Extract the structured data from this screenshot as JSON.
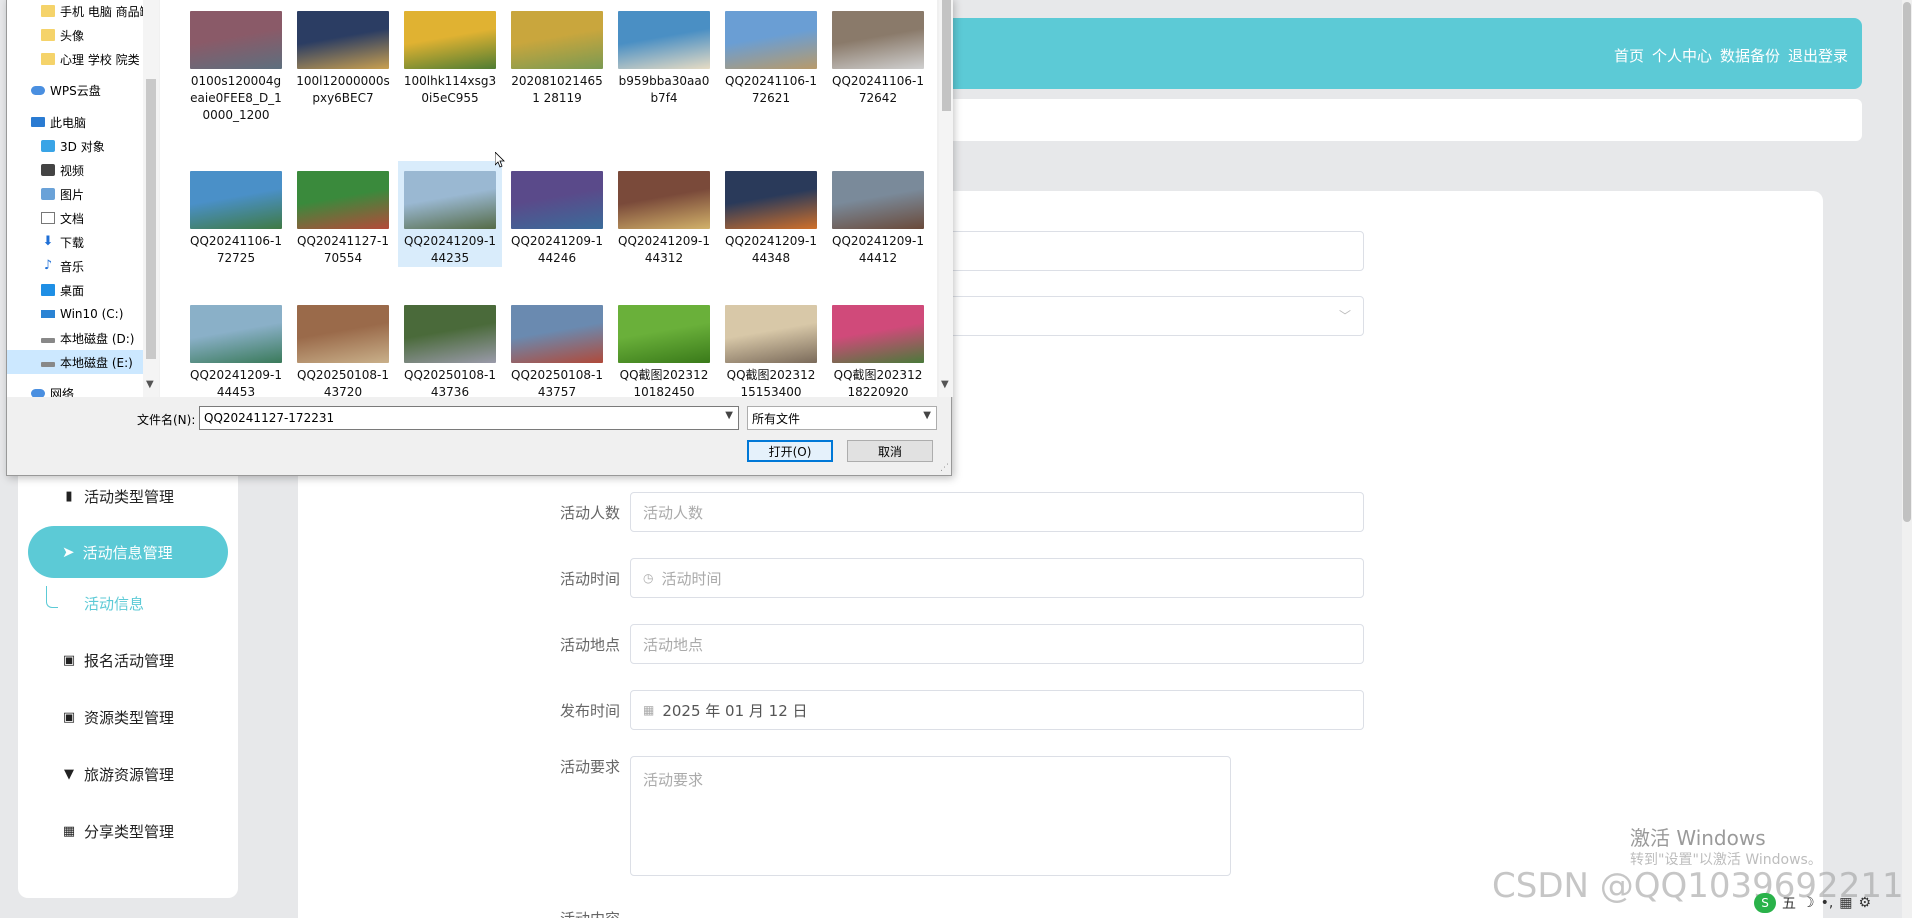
{
  "header": {
    "nav": [
      "首页",
      "个人中心",
      "数据备份",
      "退出登录"
    ],
    "accent": "#5ccad6"
  },
  "sidebar": {
    "items": [
      {
        "label": "活动类型管理",
        "icon": "clipboard-icon",
        "glyph": "▮"
      },
      {
        "label": "报名活动管理",
        "icon": "clipboard-check-icon",
        "glyph": "▣"
      },
      {
        "label": "资源类型管理",
        "icon": "clipboard-x-icon",
        "glyph": "▣"
      },
      {
        "label": "旅游资源管理",
        "icon": "flag-icon",
        "glyph": "▼"
      },
      {
        "label": "分享类型管理",
        "icon": "grid-icon",
        "glyph": "▦"
      }
    ],
    "active": {
      "label": "活动信息管理",
      "icon": "send-icon",
      "glyph": "➤"
    },
    "sub_item": "活动信息"
  },
  "form": {
    "fields": [
      {
        "label": "活动人数",
        "placeholder": "活动人数",
        "value": ""
      },
      {
        "label": "活动时间",
        "placeholder": "活动时间",
        "value": "",
        "icon": "clock-icon"
      },
      {
        "label": "活动地点",
        "placeholder": "活动地点",
        "value": ""
      },
      {
        "label": "发布时间",
        "placeholder": "",
        "value": "2025 年 01 月 12 日",
        "icon": "calendar-icon"
      }
    ],
    "textarea": {
      "label": "活动要求",
      "placeholder": "活动要求"
    },
    "partial_label": "活动内容"
  },
  "dialog": {
    "nav_items": [
      {
        "label": "手机 电脑 商品缺",
        "icon": "folder-icon"
      },
      {
        "label": "头像",
        "icon": "folder-icon"
      },
      {
        "label": "心理 学校 院类",
        "icon": "folder-icon"
      },
      {
        "label": "WPS云盘",
        "icon": "cloud-icon"
      },
      {
        "label": "此电脑",
        "icon": "computer-icon"
      },
      {
        "label": "3D 对象",
        "icon": "cube-icon"
      },
      {
        "label": "视频",
        "icon": "video-icon"
      },
      {
        "label": "图片",
        "icon": "picture-icon"
      },
      {
        "label": "文档",
        "icon": "document-icon"
      },
      {
        "label": "下载",
        "icon": "download-icon"
      },
      {
        "label": "音乐",
        "icon": "music-icon"
      },
      {
        "label": "桌面",
        "icon": "desktop-icon"
      },
      {
        "label": "Win10 (C:)",
        "icon": "windows-drive-icon"
      },
      {
        "label": "本地磁盘 (D:)",
        "icon": "drive-icon"
      },
      {
        "label": "本地磁盘 (E:)",
        "icon": "drive-icon"
      },
      {
        "label": "网络",
        "icon": "network-icon"
      }
    ],
    "selected_nav": "本地磁盘 (E:)",
    "files": [
      {
        "name": "0100s120004geaie0FEE8_D_10000_1200",
        "c1": "#8a5a68",
        "c2": "#5d6f7e"
      },
      {
        "name": "100l12000000spxy6BEC7",
        "c1": "#2b3d63",
        "c2": "#c9a050"
      },
      {
        "name": "100lhk114xsg30i5eC955",
        "c1": "#e0b232",
        "c2": "#4f7d33"
      },
      {
        "name": "2020810214651 28119",
        "c1": "#c9a63d",
        "c2": "#7a9a52"
      },
      {
        "name": "b959bba30aa0b7f4",
        "c1": "#4a8fc4",
        "c2": "#e7dcc4"
      },
      {
        "name": "QQ20241106-172621",
        "c1": "#6a9ed4",
        "c2": "#b89a6a"
      },
      {
        "name": "QQ20241106-172642",
        "c1": "#8a7a6a",
        "c2": "#d0d0d0"
      },
      {
        "name": "QQ20241106-172725",
        "c1": "#4a90c8",
        "c2": "#3f7a44"
      },
      {
        "name": "QQ20241127-170554",
        "c1": "#3a8a3c",
        "c2": "#b54a3a"
      },
      {
        "name": "QQ20241209-144235",
        "c1": "#9ab8d2",
        "c2": "#556b47"
      },
      {
        "name": "QQ20241209-144246",
        "c1": "#5a4a8a",
        "c2": "#3a6c9a"
      },
      {
        "name": "QQ20241209-144312",
        "c1": "#7a4a3a",
        "c2": "#d2b26a"
      },
      {
        "name": "QQ20241209-144348",
        "c1": "#2a3a5a",
        "c2": "#d0702a"
      },
      {
        "name": "QQ20241209-144412",
        "c1": "#7a8a9a",
        "c2": "#6a4a3a"
      },
      {
        "name": "QQ20241209-144453",
        "c1": "#8ab0c8",
        "c2": "#3a7a5a"
      },
      {
        "name": "QQ20250108-143720",
        "c1": "#9a6a4a",
        "c2": "#c9b08a"
      },
      {
        "name": "QQ20250108-143736",
        "c1": "#4a6a3a",
        "c2": "#9a9aaa"
      },
      {
        "name": "QQ20250108-143757",
        "c1": "#6a8ab0",
        "c2": "#b04a3a"
      },
      {
        "name": "QQ截图20231210182450",
        "c1": "#6ab03a",
        "c2": "#3a7a1a"
      },
      {
        "name": "QQ截图20231215153400",
        "c1": "#d8c8a8",
        "c2": "#7a6a5a"
      },
      {
        "name": "QQ截图20231218220920",
        "c1": "#d04a7a",
        "c2": "#4a7a3a"
      }
    ],
    "selected_file": "QQ20241209-144235",
    "filename_label": "文件名(N):",
    "filename_value": "QQ20241127-172231",
    "filetype_value": "所有文件",
    "open_label": "打开(O)",
    "cancel_label": "取消"
  },
  "watermarks": {
    "activate": "激活 Windows",
    "activate_sub": "转到\"设置\"以激活 Windows。",
    "csdn": "CSDN @QQ1039692211"
  },
  "tray": {
    "ime": "S",
    "items": [
      "五",
      "☽",
      "•,",
      "▦",
      "⚙"
    ]
  }
}
